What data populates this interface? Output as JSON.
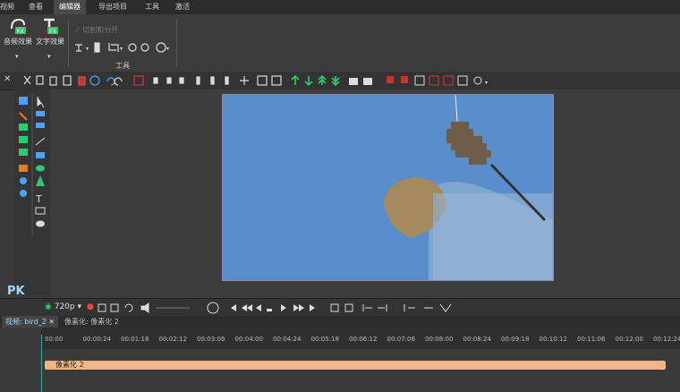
{
  "menu": {
    "items": [
      "视频",
      "查看",
      "编辑器",
      "导出项目",
      "工具",
      "激活"
    ],
    "active_index": 2
  },
  "ribbon": {
    "audio_effects": "音频效果",
    "text_effects": "文字效果",
    "split_tool": "切割和分开",
    "group_label": "工具"
  },
  "preview": {
    "resolution": "720p"
  },
  "tabs": [
    "视频: bird_2",
    "像素化: 像素化 2"
  ],
  "ruler": {
    "labels": [
      "00:00",
      "00:00:24",
      "00:01:18",
      "00:02:12",
      "00:03:06",
      "00:04:00",
      "00:04:24",
      "00:05:18",
      "00:06:12",
      "00:07:06",
      "00:08:00",
      "00:08:24",
      "00:09:18",
      "00:10:12",
      "00:11:06",
      "00:12:00",
      "00:12:24"
    ]
  },
  "clip": {
    "label": "像素化 2"
  },
  "watermark": "PK",
  "colors": {
    "accent": "#3fa8a0",
    "clip": "#f0b784",
    "green": "#2ecc71"
  }
}
